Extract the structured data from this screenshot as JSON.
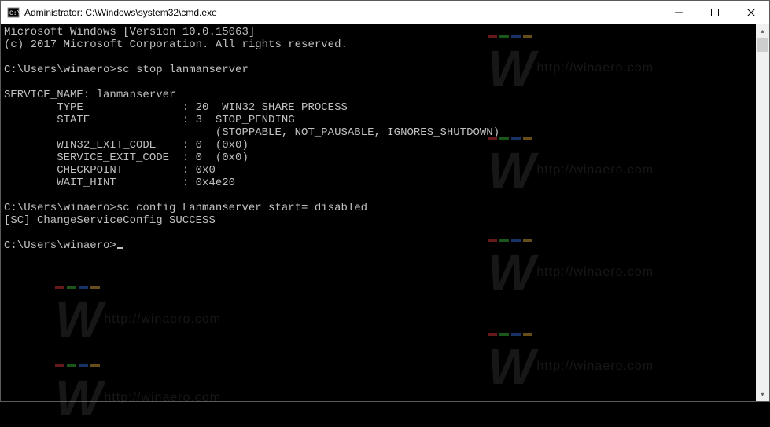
{
  "titlebar": {
    "title": "Administrator: C:\\Windows\\system32\\cmd.exe"
  },
  "terminal": {
    "lines": [
      "Microsoft Windows [Version 10.0.15063]",
      "(c) 2017 Microsoft Corporation. All rights reserved.",
      "",
      "C:\\Users\\winaero>sc stop lanmanserver",
      "",
      "SERVICE_NAME: lanmanserver",
      "        TYPE               : 20  WIN32_SHARE_PROCESS",
      "        STATE              : 3  STOP_PENDING",
      "                                (STOPPABLE, NOT_PAUSABLE, IGNORES_SHUTDOWN)",
      "        WIN32_EXIT_CODE    : 0  (0x0)",
      "        SERVICE_EXIT_CODE  : 0  (0x0)",
      "        CHECKPOINT         : 0x0",
      "        WAIT_HINT          : 0x4e20",
      "",
      "C:\\Users\\winaero>sc config Lanmanserver start= disabled",
      "[SC] ChangeServiceConfig SUCCESS",
      "",
      "C:\\Users\\winaero>"
    ]
  },
  "watermark": {
    "text": "http://winaero.com"
  }
}
